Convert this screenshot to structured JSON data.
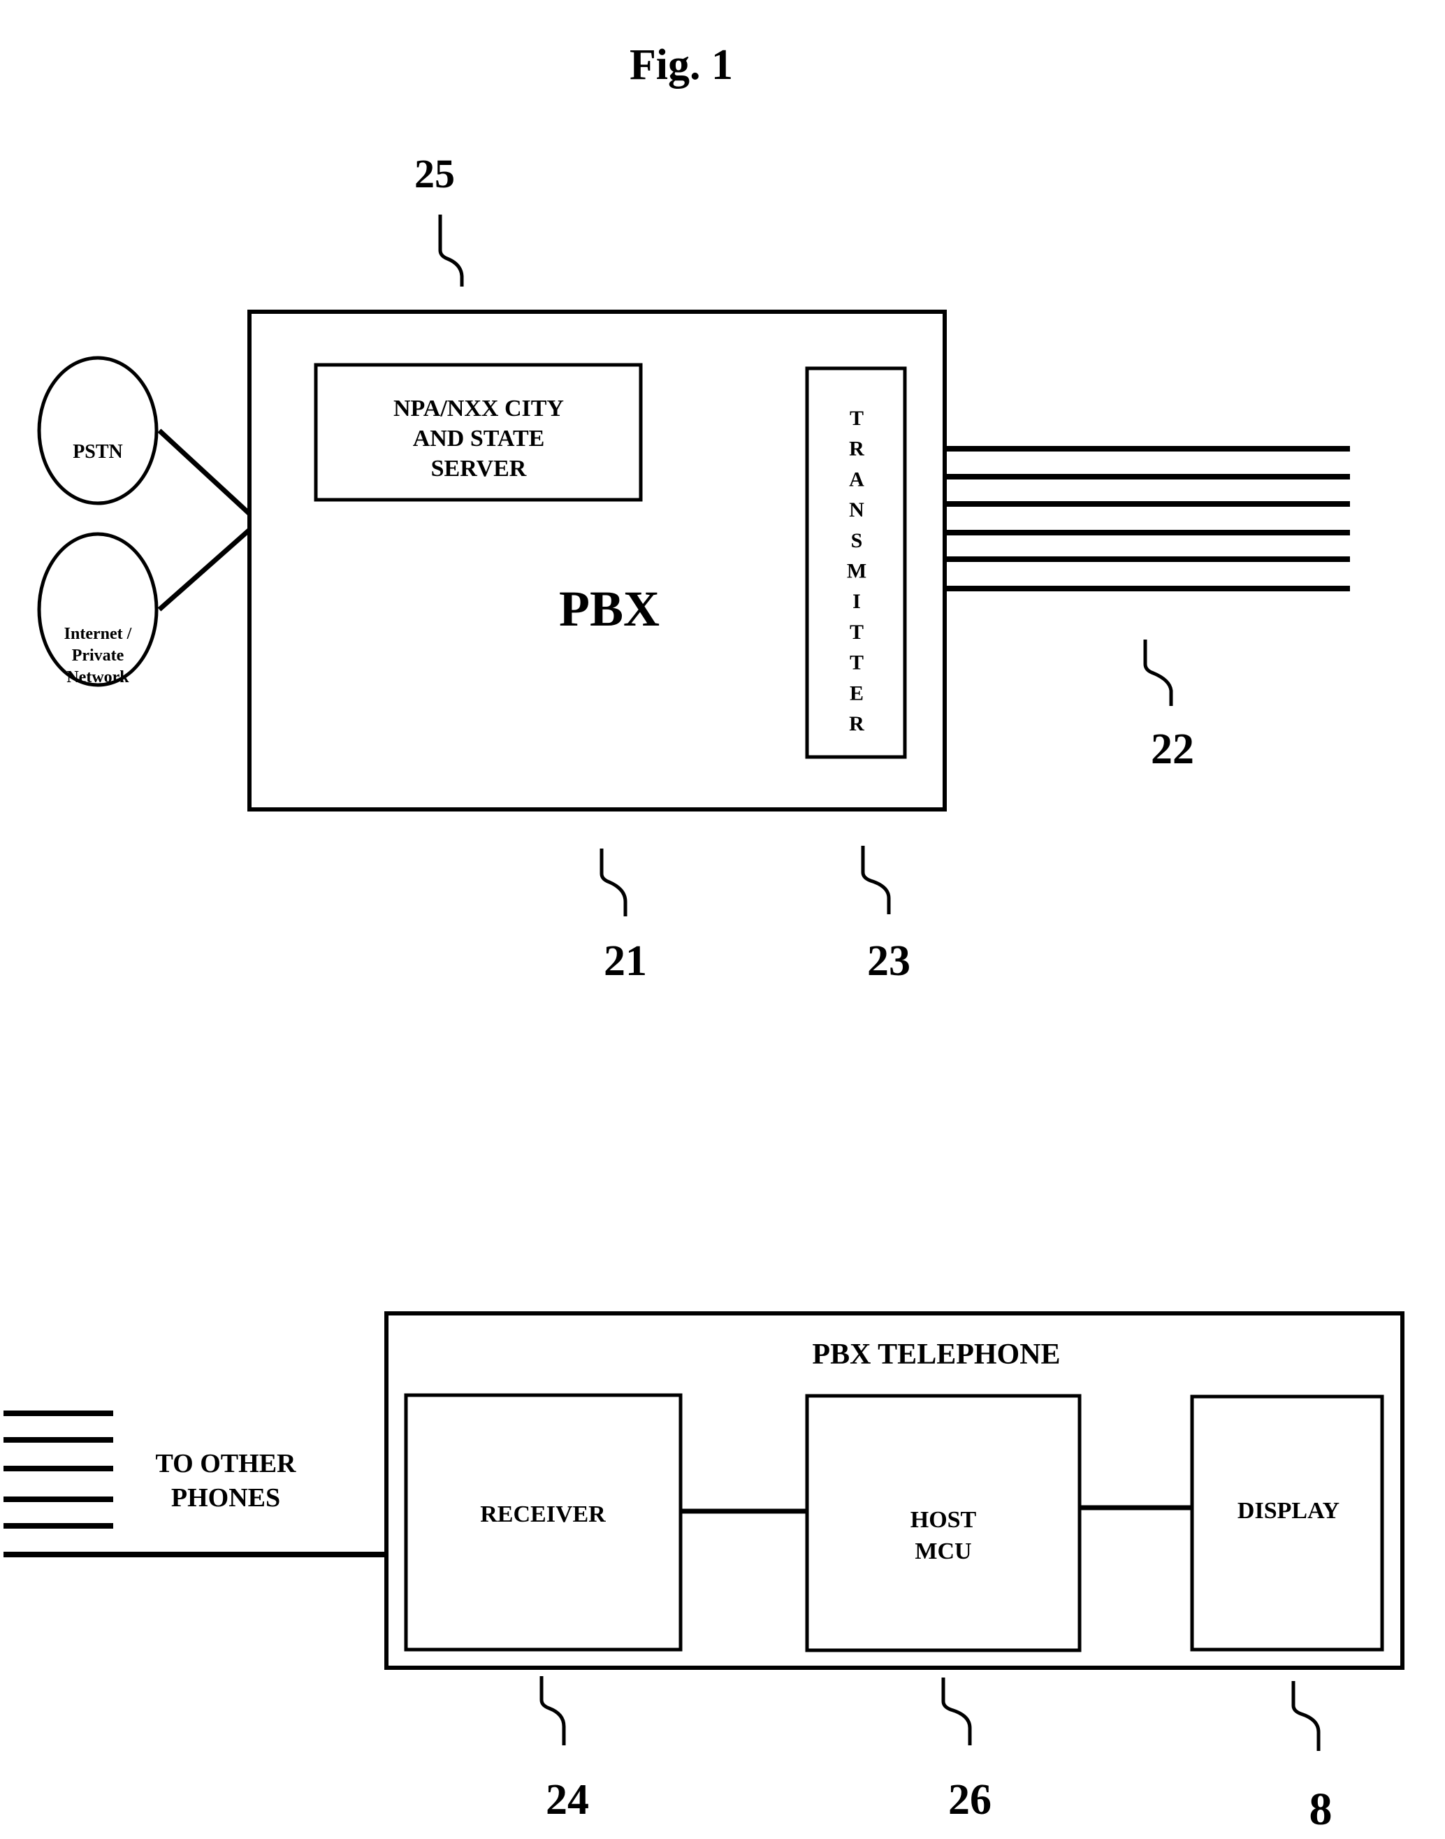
{
  "figure": {
    "title": "Fig. 1"
  },
  "top": {
    "pbx": {
      "label": "PBX",
      "ref": "21"
    },
    "server": {
      "lines": [
        "NPA/NXX CITY",
        "AND STATE",
        "SERVER"
      ],
      "ref": "25"
    },
    "transmitter": {
      "letters": [
        "T",
        "R",
        "A",
        "N",
        "S",
        "M",
        "I",
        "T",
        "T",
        "E",
        "R"
      ],
      "ref": "23"
    },
    "lines_ref": "22",
    "networks": [
      {
        "lines": [
          "PSTN"
        ]
      },
      {
        "lines": [
          "Internet /",
          "Private",
          "Network"
        ]
      }
    ]
  },
  "bottom": {
    "telephone": {
      "label": "PBX TELEPHONE"
    },
    "to_other_phones": [
      "TO OTHER",
      "PHONES"
    ],
    "receiver": {
      "label": "RECEIVER",
      "ref": "24"
    },
    "host": {
      "lines": [
        "HOST",
        "MCU"
      ],
      "ref": "26"
    },
    "display": {
      "label": "DISPLAY",
      "ref": "8"
    }
  }
}
